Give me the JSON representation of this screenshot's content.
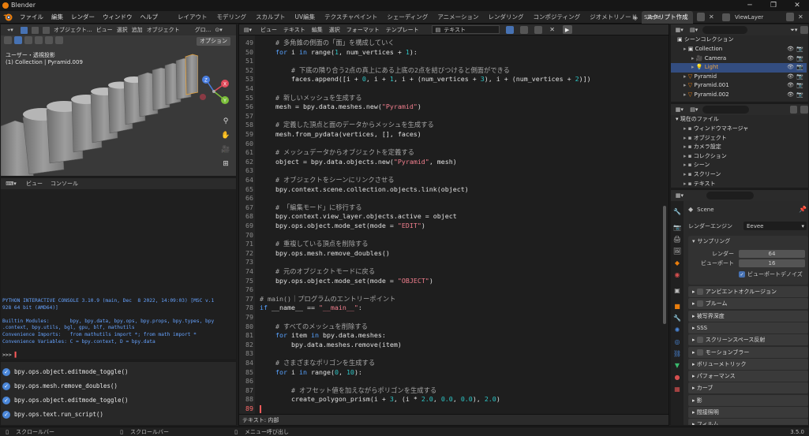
{
  "window": {
    "title": "Blender",
    "version": "3.5.0"
  },
  "menu": [
    "ファイル",
    "編集",
    "レンダー",
    "ウィンドウ",
    "ヘルプ"
  ],
  "workspaces": {
    "tabs": [
      "レイアウト",
      "モデリング",
      "スカルプト",
      "UV編集",
      "テクスチャペイント",
      "シェーディング",
      "アニメーション",
      "レンダリング",
      "コンポジティング",
      "ジオメトリノード",
      "スクリプト作成"
    ],
    "active": "スクリプト作成",
    "add": "+"
  },
  "scene": {
    "scene_name": "Scene",
    "view_layer": "ViewLayer"
  },
  "viewport": {
    "header": [
      "オブジェクト...",
      "ビュー",
      "選択",
      "追加",
      "オブジェクト"
    ],
    "orientation": "グロ...",
    "options": "オプション",
    "overlay_line1": "ユーザー・透視投影",
    "overlay_line2": "(1) Collection | Pyramid.009",
    "gizmo": [
      "X",
      "Y",
      "Z"
    ]
  },
  "console": {
    "header": [
      "ビュー",
      "コンソール"
    ],
    "banner": [
      "PYTHON INTERACTIVE CONSOLE 3.10.9 (main, Dec  8 2022, 14:09:03) [MSC v.1",
      "928 64 bit (AMD64)]",
      "",
      "Builtin Modules:       bpy, bpy.data, bpy.ops, bpy.props, bpy.types, bpy",
      ".context, bpy.utils, bgl, gpu, blf, mathutils",
      "Convenience Imports:   from mathutils import *; from math import *",
      "Convenience Variables: C = bpy.context, D = bpy.data"
    ],
    "prompt": ">>> ",
    "info_items": [
      "bpy.ops.object.editmode_toggle()",
      "bpy.ops.mesh.remove_doubles()",
      "bpy.ops.object.editmode_toggle()",
      "bpy.ops.text.run_script()"
    ]
  },
  "text_editor": {
    "header": [
      "ビュー",
      "テキスト",
      "編集",
      "選択",
      "フォーマット",
      "テンプレート"
    ],
    "text_name": "テキスト",
    "footer": "テキスト: 内部",
    "lines": [
      {
        "n": 49,
        "t": [
          [
            "cm",
            "    # 多角錐の側面の「面」を構成していく"
          ]
        ]
      },
      {
        "n": 50,
        "t": [
          [
            "kw",
            "    for"
          ],
          [
            "sp",
            " i "
          ],
          [
            "kw",
            "in"
          ],
          [
            "sp",
            " range("
          ],
          [
            "nm",
            "1"
          ],
          [
            "sp",
            ", num_vertices + "
          ],
          [
            "nm",
            "1"
          ],
          [
            "sp",
            "):"
          ]
        ]
      },
      {
        "n": 51,
        "t": []
      },
      {
        "n": 52,
        "t": [
          [
            "cm",
            "        # 下底の隣り合う2点の真上にある上底の2点を結びつけると側面ができる"
          ]
        ]
      },
      {
        "n": 53,
        "t": [
          [
            "sp",
            "        faces.append([i + "
          ],
          [
            "nm",
            "0"
          ],
          [
            "sp",
            ", i + "
          ],
          [
            "nm",
            "1"
          ],
          [
            "sp",
            ", i + (num_vertices + "
          ],
          [
            "nm",
            "3"
          ],
          [
            "sp",
            "), i + (num_vertices + "
          ],
          [
            "nm",
            "2"
          ],
          [
            "sp",
            ")])"
          ]
        ]
      },
      {
        "n": 54,
        "t": []
      },
      {
        "n": 55,
        "t": [
          [
            "cm",
            "    # 新しいメッシュを生成する"
          ]
        ]
      },
      {
        "n": 56,
        "t": [
          [
            "sp",
            "    mesh = bpy.data.meshes.new("
          ],
          [
            "st",
            "\"Pyramid\""
          ],
          [
            "sp",
            ")"
          ]
        ]
      },
      {
        "n": 57,
        "t": []
      },
      {
        "n": 58,
        "t": [
          [
            "cm",
            "    # 定義した頂点と面のデータからメッシュを生成する"
          ]
        ]
      },
      {
        "n": 59,
        "t": [
          [
            "sp",
            "    mesh.from_pydata(vertices, [], faces)"
          ]
        ]
      },
      {
        "n": 60,
        "t": []
      },
      {
        "n": 61,
        "t": [
          [
            "cm",
            "    # メッシュデータからオブジェクトを定義する"
          ]
        ]
      },
      {
        "n": 62,
        "t": [
          [
            "sp",
            "    object = bpy.data.objects.new("
          ],
          [
            "st",
            "\"Pyramid\""
          ],
          [
            "sp",
            ", mesh)"
          ]
        ]
      },
      {
        "n": 63,
        "t": []
      },
      {
        "n": 64,
        "t": [
          [
            "cm",
            "    # オブジェクトをシーンにリンクさせる"
          ]
        ]
      },
      {
        "n": 65,
        "t": [
          [
            "sp",
            "    bpy.context.scene.collection.objects.link(object)"
          ]
        ]
      },
      {
        "n": 66,
        "t": []
      },
      {
        "n": 67,
        "t": [
          [
            "cm",
            "    # 「編集モード」に移行する"
          ]
        ]
      },
      {
        "n": 68,
        "t": [
          [
            "sp",
            "    bpy.context.view_layer.objects.active = object"
          ]
        ]
      },
      {
        "n": 69,
        "t": [
          [
            "sp",
            "    bpy.ops.object.mode_set(mode = "
          ],
          [
            "st",
            "\"EDIT\""
          ],
          [
            "sp",
            ")"
          ]
        ]
      },
      {
        "n": 70,
        "t": []
      },
      {
        "n": 71,
        "t": [
          [
            "cm",
            "    # 重複している頂点を削除する"
          ]
        ]
      },
      {
        "n": 72,
        "t": [
          [
            "sp",
            "    bpy.ops.mesh.remove_doubles()"
          ]
        ]
      },
      {
        "n": 73,
        "t": []
      },
      {
        "n": 74,
        "t": [
          [
            "cm",
            "    # 元のオブジェクトモードに戻る"
          ]
        ]
      },
      {
        "n": 75,
        "t": [
          [
            "sp",
            "    bpy.ops.object.mode_set(mode = "
          ],
          [
            "st",
            "\"OBJECT\""
          ],
          [
            "sp",
            ")"
          ]
        ]
      },
      {
        "n": 76,
        "t": []
      },
      {
        "n": 77,
        "t": [
          [
            "cm",
            "# main()｜プログラムのエントリーポイント"
          ]
        ]
      },
      {
        "n": 78,
        "t": [
          [
            "kw",
            "if"
          ],
          [
            "sp",
            " __name__ == "
          ],
          [
            "st",
            "\"__main__\""
          ],
          [
            "sp",
            ":"
          ]
        ]
      },
      {
        "n": 79,
        "t": []
      },
      {
        "n": 80,
        "t": [
          [
            "cm",
            "    # すべてのメッシュを削除する"
          ]
        ]
      },
      {
        "n": 81,
        "t": [
          [
            "kw",
            "    for"
          ],
          [
            "sp",
            " item "
          ],
          [
            "kw",
            "in"
          ],
          [
            "sp",
            " bpy.data.meshes:"
          ]
        ]
      },
      {
        "n": 82,
        "t": [
          [
            "sp",
            "        bpy.data.meshes.remove(item)"
          ]
        ]
      },
      {
        "n": 83,
        "t": []
      },
      {
        "n": 84,
        "t": [
          [
            "cm",
            "    # さまざまなポリゴンを生成する"
          ]
        ]
      },
      {
        "n": 85,
        "t": [
          [
            "kw",
            "    for"
          ],
          [
            "sp",
            " i "
          ],
          [
            "kw",
            "in"
          ],
          [
            "sp",
            " range("
          ],
          [
            "nm",
            "0"
          ],
          [
            "sp",
            ", "
          ],
          [
            "nm",
            "10"
          ],
          [
            "sp",
            "):"
          ]
        ]
      },
      {
        "n": 86,
        "t": []
      },
      {
        "n": 87,
        "t": [
          [
            "cm",
            "        # オフセット値を加えながらポリゴンを生成する"
          ]
        ]
      },
      {
        "n": 88,
        "t": [
          [
            "sp",
            "        create_polygon_prism(i + "
          ],
          [
            "nm",
            "3"
          ],
          [
            "sp",
            ", (i * "
          ],
          [
            "nm",
            "2.0"
          ],
          [
            "sp",
            ", "
          ],
          [
            "nm",
            "0.0"
          ],
          [
            "sp",
            ", "
          ],
          [
            "nm",
            "0.0"
          ],
          [
            "sp",
            "), "
          ],
          [
            "nm",
            "2.0"
          ],
          [
            "sp",
            ")"
          ]
        ]
      },
      {
        "n": 89,
        "t": []
      }
    ]
  },
  "outliner": {
    "root": "シーンコレクション",
    "items": [
      {
        "label": "Collection",
        "depth": 1,
        "color": "#dddddd"
      },
      {
        "label": "Camera",
        "depth": 2,
        "color": "#dddddd"
      },
      {
        "label": "Light",
        "depth": 2,
        "color": "#e7a449"
      },
      {
        "label": "Pyramid",
        "depth": 1,
        "color": "#dddddd"
      },
      {
        "label": "Pyramid.001",
        "depth": 1,
        "color": "#dddddd"
      },
      {
        "label": "Pyramid.002",
        "depth": 1,
        "color": "#dddddd"
      }
    ]
  },
  "data_browser": {
    "root": "現在のファイル",
    "items": [
      "ウィンドウマネージャ",
      "オブジェクト",
      "カメラ設定",
      "コレクション",
      "シーン",
      "スクリーン",
      "テキスト"
    ]
  },
  "properties": {
    "scene_label": "Scene",
    "render_engine_label": "レンダーエンジン",
    "render_engine_value": "Eevee",
    "sampling": {
      "title": "サンプリング",
      "render_label": "レンダー",
      "render_value": "64",
      "viewport_label": "ビューポート",
      "viewport_value": "16",
      "denoise_label": "ビューポートデノイズ"
    },
    "panels": [
      "アンビエントオクルージョン",
      "ブルーム",
      "被写界深度",
      "SSS",
      "スクリーンスペース反射",
      "モーションブラー",
      "ボリューメトリック",
      "パフォーマンス",
      "カーブ",
      "影",
      "間接照明",
      "フィルム"
    ]
  },
  "statusbar": {
    "items": [
      "スクロールバー",
      "スクロールバー",
      "メニュー呼び出し"
    ],
    "version": "3.5.0"
  },
  "colors": {
    "accent": "#4772b3",
    "selected_row": "#334d80",
    "active_tab": "#3d3d3d",
    "background": "#1d1d1d"
  }
}
